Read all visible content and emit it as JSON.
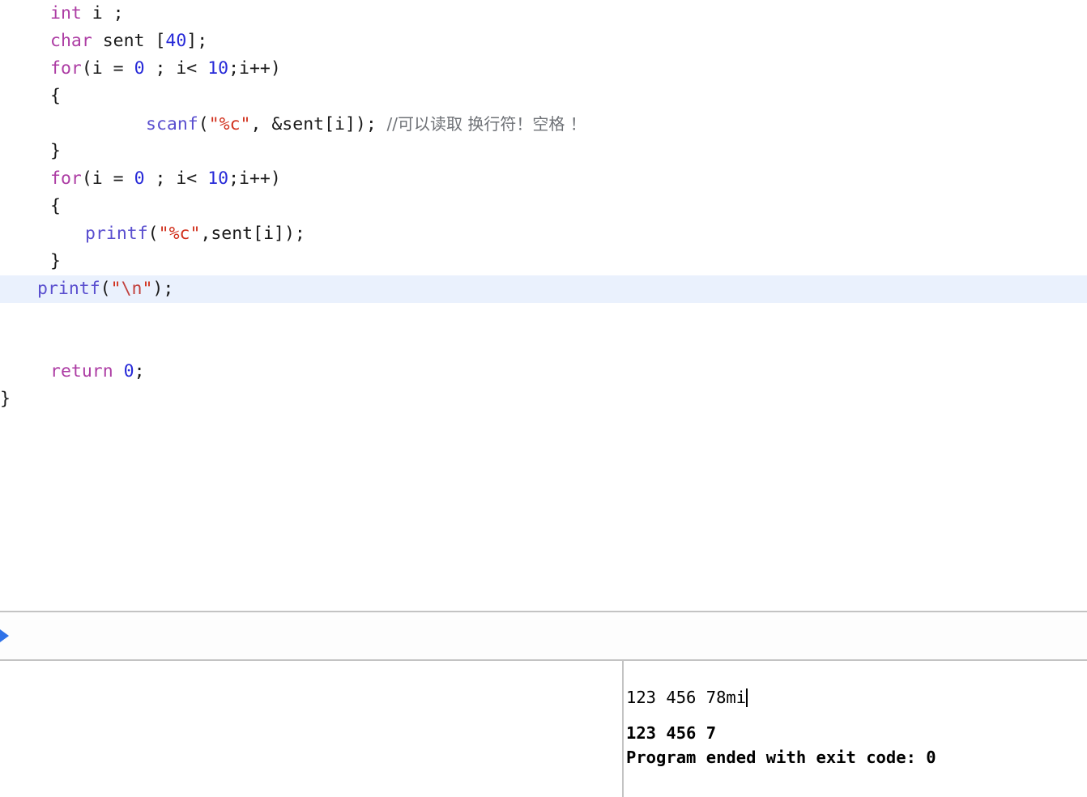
{
  "editor": {
    "name": "source-code-editor",
    "language": "c",
    "highlighted_line_index": 9,
    "lines": [
      {
        "indent": 62,
        "tokens": [
          {
            "t": "int",
            "c": "kw"
          },
          {
            "t": " i ;",
            "c": "pl"
          }
        ]
      },
      {
        "indent": 62,
        "tokens": [
          {
            "t": "char",
            "c": "kw"
          },
          {
            "t": " sent [",
            "c": "pl"
          },
          {
            "t": "40",
            "c": "num"
          },
          {
            "t": "];",
            "c": "pl"
          }
        ]
      },
      {
        "indent": 62,
        "tokens": [
          {
            "t": "for",
            "c": "kw"
          },
          {
            "t": "(i = ",
            "c": "pl"
          },
          {
            "t": "0",
            "c": "num"
          },
          {
            "t": " ; i< ",
            "c": "pl"
          },
          {
            "t": "10",
            "c": "num"
          },
          {
            "t": ";i++)",
            "c": "pl"
          }
        ]
      },
      {
        "indent": 62,
        "tokens": [
          {
            "t": "{",
            "c": "pl"
          }
        ]
      },
      {
        "indent": 180,
        "tokens": [
          {
            "t": "scanf",
            "c": "fn"
          },
          {
            "t": "(",
            "c": "pl"
          },
          {
            "t": "\"%c\"",
            "c": "str"
          },
          {
            "t": ", &sent[i]);",
            "c": "pl"
          },
          {
            "t": "  //可以读取 换行符！空格 ！",
            "c": "cmt"
          }
        ]
      },
      {
        "indent": 62,
        "tokens": [
          {
            "t": "}",
            "c": "pl"
          }
        ]
      },
      {
        "indent": 62,
        "tokens": [
          {
            "t": "for",
            "c": "kw"
          },
          {
            "t": "(i = ",
            "c": "pl"
          },
          {
            "t": "0",
            "c": "num"
          },
          {
            "t": " ; i< ",
            "c": "pl"
          },
          {
            "t": "10",
            "c": "num"
          },
          {
            "t": ";i++)",
            "c": "pl"
          }
        ]
      },
      {
        "indent": 62,
        "tokens": [
          {
            "t": "{",
            "c": "pl"
          }
        ]
      },
      {
        "indent": 105,
        "tokens": [
          {
            "t": "printf",
            "c": "fn"
          },
          {
            "t": "(",
            "c": "pl"
          },
          {
            "t": "\"%c\"",
            "c": "str"
          },
          {
            "t": ",sent[i]);",
            "c": "pl"
          }
        ]
      },
      {
        "indent": 62,
        "tokens": [
          {
            "t": "}",
            "c": "pl"
          }
        ]
      },
      {
        "indent": 46,
        "highlight": true,
        "tokens": [
          {
            "t": "printf",
            "c": "fn"
          },
          {
            "t": "(",
            "c": "pl"
          },
          {
            "t": "\"",
            "c": "str"
          },
          {
            "t": "\\n",
            "c": "esc"
          },
          {
            "t": "\"",
            "c": "str"
          },
          {
            "t": ");",
            "c": "pl"
          }
        ]
      },
      {
        "indent": 62,
        "tokens": []
      },
      {
        "indent": 62,
        "tokens": []
      },
      {
        "indent": 62,
        "tokens": [
          {
            "t": "return",
            "c": "kw"
          },
          {
            "t": " ",
            "c": "pl"
          },
          {
            "t": "0",
            "c": "num"
          },
          {
            "t": ";",
            "c": "pl"
          }
        ]
      },
      {
        "indent": 0,
        "tokens": [
          {
            "t": "}",
            "c": "pl"
          }
        ]
      }
    ]
  },
  "jumpbar": {
    "arrow_icon": "play-arrow-icon",
    "arrow_color": "#2f72e8"
  },
  "variables_pane": {
    "name": "variables-view",
    "content": ""
  },
  "console": {
    "name": "debug-console",
    "input_line": "123 456 78mi",
    "output_lines": [
      "123 456 7",
      "Program ended with exit code: 0"
    ]
  },
  "colors": {
    "keyword": "#ad3da4",
    "number": "#272ad8",
    "function": "#5a4fcf",
    "string": "#d12f1b",
    "escape": "#c1403d",
    "comment": "#6e7176",
    "plain": "#1a1a1a",
    "highlight_band": "#eaf1fd",
    "rule": "#c3c3c3",
    "background": "#ffffff"
  }
}
